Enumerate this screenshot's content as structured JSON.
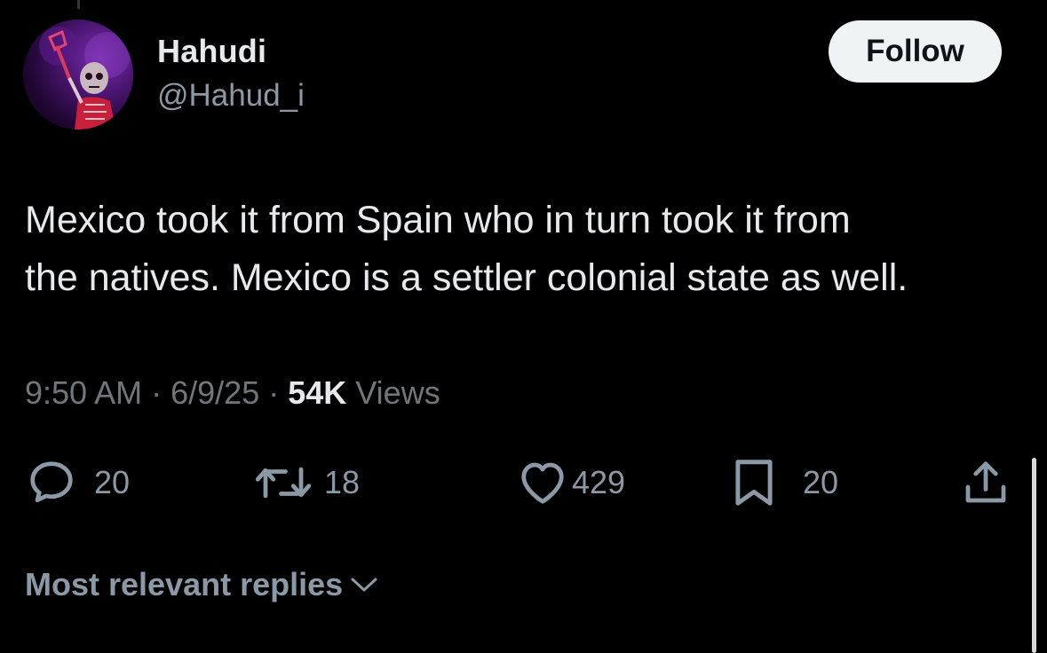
{
  "author": {
    "display_name": "Hahudi",
    "handle": "@Hahud_i"
  },
  "follow_label": "Follow",
  "tweet": {
    "text_line1": "Mexico took it from Spain who in turn took it from",
    "text_line2": "the natives. Mexico is a settler colonial state as well.",
    "time": "9:50 AM",
    "date": "6/9/25",
    "separator": "·",
    "views_count": "54K",
    "views_label": "Views"
  },
  "actions": {
    "replies": "20",
    "reposts": "18",
    "likes": "429",
    "bookmarks": "20"
  },
  "replies_sort_label": "Most relevant replies",
  "icons": {
    "reply": "reply-icon",
    "repost": "repost-icon",
    "like": "heart-icon",
    "bookmark": "bookmark-icon",
    "share": "share-icon",
    "sort": "chevron-down-icon"
  },
  "colors": {
    "background": "#000000",
    "text_primary": "#e7e9ea",
    "text_secondary": "#71767b",
    "follow_bg": "#eff3f4"
  }
}
